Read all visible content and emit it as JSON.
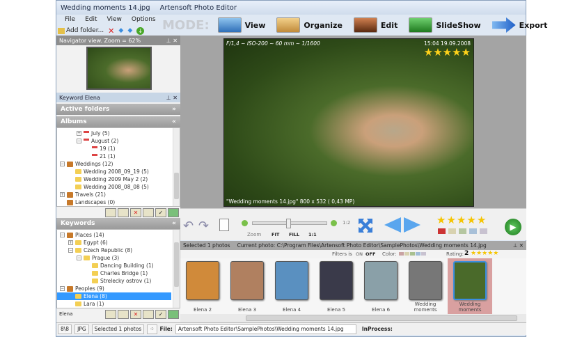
{
  "window": {
    "title": "Wedding moments 14.jpg",
    "app": "Artensoft Photo Editor"
  },
  "menu": [
    "File",
    "Edit",
    "View",
    "Options"
  ],
  "toolbar": {
    "add_folder": "Add folder..."
  },
  "mode": {
    "label": "MODE:",
    "buttons": [
      {
        "label": "View",
        "color": "#3b7dc4"
      },
      {
        "label": "Organize",
        "color": "#d9a441"
      },
      {
        "label": "Edit",
        "color": "#a05030"
      },
      {
        "label": "SlideShow",
        "color": "#3aa83a"
      },
      {
        "label": "Export",
        "color": "#3377dd"
      }
    ]
  },
  "navigator": {
    "title": "Navigator view. Zoom = 62%"
  },
  "keyword_panel": {
    "title": "Keyword Elena"
  },
  "active_folders": "Active folders",
  "albums": {
    "title": "Albums",
    "items": [
      {
        "label": "July  (5)",
        "level": 2,
        "icon": "calendar",
        "toggle": "+"
      },
      {
        "label": "August  (2)",
        "level": 2,
        "icon": "calendar",
        "toggle": "-"
      },
      {
        "label": "19  (1)",
        "level": 3,
        "icon": "calendar"
      },
      {
        "label": "21  (1)",
        "level": 3,
        "icon": "calendar"
      },
      {
        "label": "Weddings  (12)",
        "level": 0,
        "icon": "case",
        "toggle": "-"
      },
      {
        "label": "Wedding 2008_09_19  (5)",
        "level": 1,
        "icon": "folder"
      },
      {
        "label": "Wedding 2009 May 2  (2)",
        "level": 1,
        "icon": "folder"
      },
      {
        "label": "Wedding 2008_08_08  (5)",
        "level": 1,
        "icon": "folder"
      },
      {
        "label": "Travels  (21)",
        "level": 0,
        "icon": "case",
        "toggle": "+"
      },
      {
        "label": "Landscapes  (0)",
        "level": 0,
        "icon": "case"
      }
    ]
  },
  "keywords": {
    "title": "Keywords",
    "items": [
      {
        "label": "Places (14)",
        "level": 0,
        "icon": "case",
        "toggle": "-"
      },
      {
        "label": "Egypt  (6)",
        "level": 1,
        "icon": "folder",
        "toggle": "+"
      },
      {
        "label": "Czech Republic  (8)",
        "level": 1,
        "icon": "folder",
        "toggle": "-"
      },
      {
        "label": "Prague (3)",
        "level": 2,
        "icon": "folder",
        "toggle": "-"
      },
      {
        "label": "Dancing Building  (1)",
        "level": 3,
        "icon": "folder"
      },
      {
        "label": "Charles Bridge  (1)",
        "level": 3,
        "icon": "folder"
      },
      {
        "label": "Strelecky ostrov  (1)",
        "level": 3,
        "icon": "folder"
      },
      {
        "label": "Peoples (9)",
        "level": 0,
        "icon": "case",
        "toggle": "-"
      },
      {
        "label": "Elena  (8)",
        "level": 1,
        "icon": "folder",
        "selected": true
      },
      {
        "label": "Lara  (1)",
        "level": 1,
        "icon": "folder"
      }
    ],
    "filter_value": "Elena"
  },
  "photo": {
    "exif": "F/1,4 ~ ISO-200 ~ 60 mm ~ 1/1600",
    "datetime": "15:04 19.09.2008",
    "rating": 5,
    "caption": "\"Wedding moments 14.jpg\"  800 x 532 ( 0,43 MP)"
  },
  "controls": {
    "zoom": "Zoom",
    "fit": "FIT",
    "fill": "FILL",
    "one": "1:1",
    "ratio": "1:2",
    "zoom_level": 0.45
  },
  "selection": {
    "selected": "Selected 1 photos",
    "current": "Current photo: C:\\Program Files\\Artensoft Photo Editor\\SamplePhotos\\Wedding moments 14.jpg"
  },
  "filters": {
    "label": "Filters is",
    "on": "ON",
    "off": "OFF",
    "color": "Color:",
    "rating": "Rating:",
    "rating_value": "2"
  },
  "thumbnails": [
    {
      "label": "Elena 2",
      "color": "#d08a3a"
    },
    {
      "label": "Elena 3",
      "color": "#b08060"
    },
    {
      "label": "Elena 4",
      "color": "#5a90c0"
    },
    {
      "label": "Elena 5",
      "color": "#3a3a4a"
    },
    {
      "label": "Elena 6",
      "color": "#8aa0a8"
    },
    {
      "label": "Wedding moments",
      "color": "#777"
    },
    {
      "label": "Wedding moments",
      "color": "#4a6a2a",
      "selected": true
    }
  ],
  "status": {
    "size": "8\\8",
    "type": "JPG",
    "selected": "Selected 1 photos",
    "file_label": "File:",
    "file": "Artensoft Photo Editor\\SamplePhotos\\Wedding moments 14.jpg",
    "inprocess": "InProcess:"
  }
}
